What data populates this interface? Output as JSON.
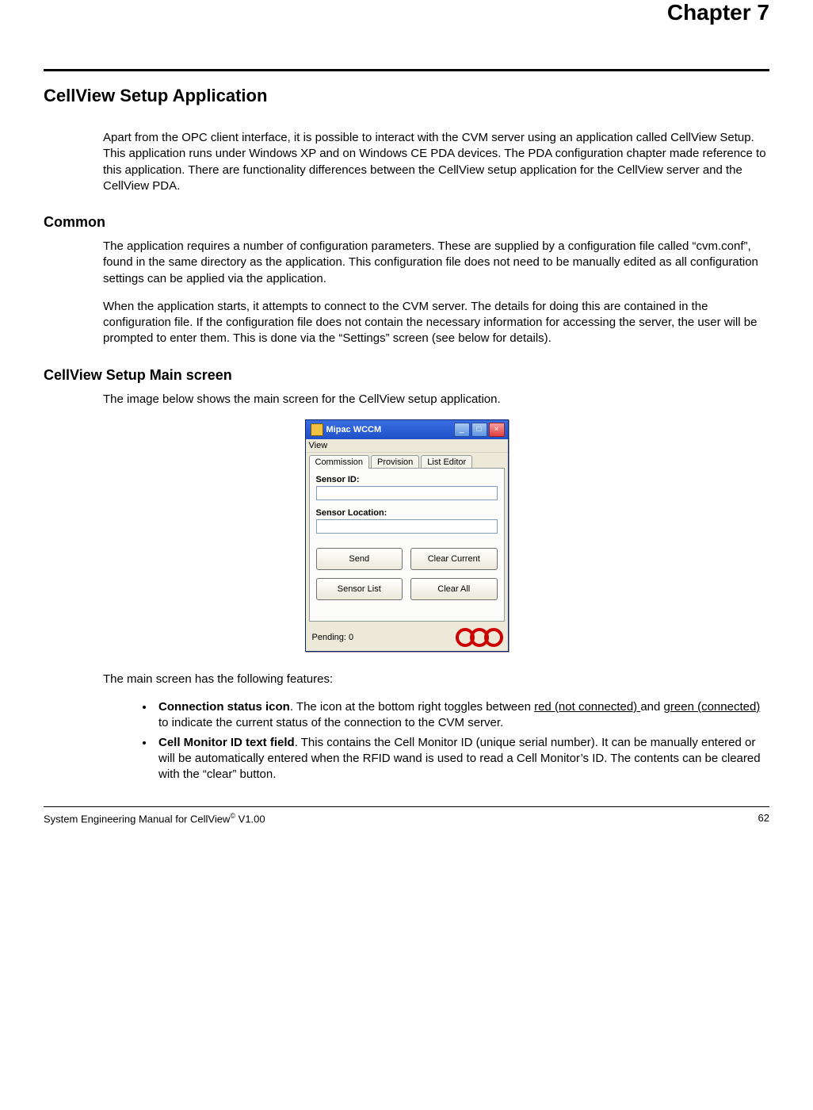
{
  "chapter": "Chapter 7",
  "section_title": "CellView Setup Application",
  "intro_paragraph": "Apart from the OPC client interface, it is possible to interact with the CVM server using an application called CellView Setup.  This application runs under Windows XP and on Windows CE PDA devices.  The PDA configuration chapter made reference to this application.  There are functionality differences between the CellView setup application for the CellView server and the CellView PDA.",
  "common": {
    "heading": "Common",
    "p1": "The application requires a number of configuration parameters.  These are supplied by a configuration file called “cvm.conf”, found in the same directory as the application.  This configuration file does not need to be manually edited as all configuration settings can be applied via the application.",
    "p2": "When the application starts, it attempts to connect to the CVM server.  The details for doing this are contained in the configuration file.  If the configuration file does not contain the necessary information for accessing the server, the user will be prompted to enter them.  This is done via the “Settings” screen (see below for details)."
  },
  "main_screen": {
    "heading": "CellView Setup Main screen",
    "intro": "The image below shows the main screen for the CellView setup application.",
    "features_intro": "The main screen has the following features:"
  },
  "app_window": {
    "title": "Mipac WCCM",
    "menu_view": "View",
    "tabs": {
      "commission": "Commission",
      "provision": "Provision",
      "list_editor": "List Editor"
    },
    "labels": {
      "sensor_id": "Sensor ID:",
      "sensor_location": "Sensor Location:"
    },
    "buttons": {
      "send": "Send",
      "clear_current": "Clear Current",
      "sensor_list": "Sensor List",
      "clear_all": "Clear All"
    },
    "status": "Pending: 0"
  },
  "features": {
    "f1_bold": "Connection status icon",
    "f1_a": ".  The icon at the bottom right toggles between ",
    "f1_u1": "red (not connected) ",
    "f1_b": "and ",
    "f1_u2": "green (connected)",
    "f1_c": " to indicate the current status of the connection to the CVM server.",
    "f2_bold": "Cell Monitor ID text field",
    "f2_rest": ".  This contains the Cell Monitor ID (unique serial number).  It can be manually entered or will be automatically entered when the RFID wand is used to read a Cell Monitor’s ID.  The contents can be cleared with the “clear” button."
  },
  "footer": {
    "left_a": "System Engineering Manual for CellView",
    "left_b": " V1.00",
    "page": "62"
  }
}
